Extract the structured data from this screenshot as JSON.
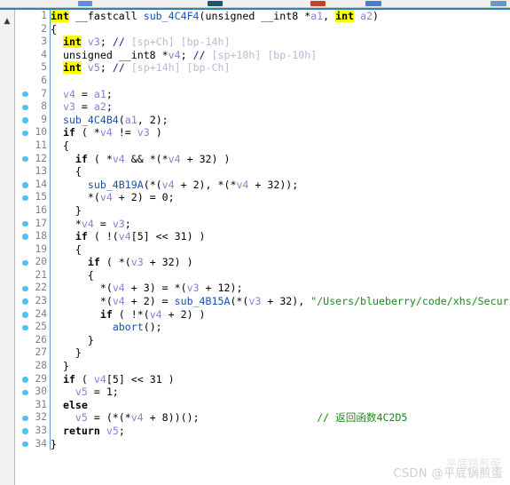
{
  "window": {
    "app": "ida-hexrays-pseudocode",
    "toolbar_icons": [
      "document-icon",
      "navigate-icon",
      "stop-icon",
      "window-icon",
      "grid-icon"
    ],
    "accent_color": "#2e82b5",
    "marker_color": "#4cc3f2",
    "keyword_highlight_color": "#ffff00",
    "string_color": "#1a8a1a",
    "variable_color": "#8a7fd4",
    "function_color": "#1a4fb4",
    "comment_color": "#1a1a8c",
    "gutter_color": "#808080"
  },
  "sidebar": {
    "collapse_icon": "chevron-up-icon"
  },
  "watermark": {
    "text": "CSDN @平底锅煎蛋",
    "ghost": "平底锅煎蛋"
  },
  "code": {
    "language": "c-pseudocode",
    "total_lines": 34,
    "lines": [
      {
        "n": "1",
        "marker": false,
        "html": "<span class=\"kw\">int</span><span class=\"pun\"> __fastcall </span><span class=\"fn\">sub_4C4F4</span><span class=\"pun\">(unsigned __int8 *</span><span class=\"var\">a1</span><span class=\"pun\">, </span><span class=\"kw\">int</span><span class=\"pun\"> </span><span class=\"var\">a2</span><span class=\"pun\">)</span>"
      },
      {
        "n": "2",
        "marker": false,
        "html": "<span class=\"pun\">{</span>"
      },
      {
        "n": "3",
        "marker": false,
        "html": "<span class=\"pun\">  </span><span class=\"kw\">int</span><span class=\"pun\"> </span><span class=\"var\">v3</span><span class=\"pun\">; </span><span class=\"cmt\">//</span><span class=\"cmt-arg\"> [sp+Ch] [bp-14h]</span>"
      },
      {
        "n": "4",
        "marker": false,
        "html": "<span class=\"pun\">  unsigned __int8 *</span><span class=\"var\">v4</span><span class=\"pun\">; </span><span class=\"cmt\">//</span><span class=\"cmt-arg\"> [sp+10h] [bp-10h]</span>"
      },
      {
        "n": "5",
        "marker": false,
        "html": "<span class=\"pun\">  </span><span class=\"kw\">int</span><span class=\"pun\"> </span><span class=\"var\">v5</span><span class=\"pun\">; </span><span class=\"cmt\">//</span><span class=\"cmt-arg\"> [sp+14h] [bp-Ch]</span>"
      },
      {
        "n": "6",
        "marker": false,
        "html": ""
      },
      {
        "n": "7",
        "marker": true,
        "html": "<span class=\"pun\">  </span><span class=\"var\">v4</span><span class=\"pun\"> = </span><span class=\"var\">a1</span><span class=\"pun\">;</span>"
      },
      {
        "n": "8",
        "marker": true,
        "html": "<span class=\"pun\">  </span><span class=\"var\">v3</span><span class=\"pun\"> = </span><span class=\"var\">a2</span><span class=\"pun\">;</span>"
      },
      {
        "n": "9",
        "marker": true,
        "html": "<span class=\"pun\">  </span><span class=\"fn\">sub_4C4B4</span><span class=\"pun\">(</span><span class=\"var\">a1</span><span class=\"pun\">, 2);</span>"
      },
      {
        "n": "10",
        "marker": true,
        "html": "<span class=\"pun\">  </span><span class=\"kw2\">if</span><span class=\"pun\"> ( *</span><span class=\"var\">v4</span><span class=\"pun\"> != </span><span class=\"var\">v3</span><span class=\"pun\"> )</span>"
      },
      {
        "n": "11",
        "marker": false,
        "html": "<span class=\"pun\">  {</span>"
      },
      {
        "n": "12",
        "marker": true,
        "html": "<span class=\"pun\">    </span><span class=\"kw2\">if</span><span class=\"pun\"> ( *</span><span class=\"var\">v4</span><span class=\"pun\"> &amp;&amp; *(*</span><span class=\"var\">v4</span><span class=\"pun\"> + 32) )</span>"
      },
      {
        "n": "13",
        "marker": false,
        "html": "<span class=\"pun\">    {</span>"
      },
      {
        "n": "14",
        "marker": true,
        "html": "<span class=\"pun\">      </span><span class=\"fn\">sub_4B19A</span><span class=\"pun\">(*(</span><span class=\"var\">v4</span><span class=\"pun\"> + 2), *(*</span><span class=\"var\">v4</span><span class=\"pun\"> + 32));</span>"
      },
      {
        "n": "15",
        "marker": true,
        "html": "<span class=\"pun\">      *(</span><span class=\"var\">v4</span><span class=\"pun\"> + 2) = 0;</span>"
      },
      {
        "n": "16",
        "marker": false,
        "html": "<span class=\"pun\">    }</span>"
      },
      {
        "n": "17",
        "marker": true,
        "html": "<span class=\"pun\">    *</span><span class=\"var\">v4</span><span class=\"pun\"> = </span><span class=\"var\">v3</span><span class=\"pun\">;</span>"
      },
      {
        "n": "18",
        "marker": true,
        "html": "<span class=\"pun\">    </span><span class=\"kw2\">if</span><span class=\"pun\"> ( !(</span><span class=\"var\">v4</span><span class=\"pun\">[5] &lt;&lt; 31) )</span>"
      },
      {
        "n": "19",
        "marker": false,
        "html": "<span class=\"pun\">    {</span>"
      },
      {
        "n": "20",
        "marker": true,
        "html": "<span class=\"pun\">      </span><span class=\"kw2\">if</span><span class=\"pun\"> ( *(</span><span class=\"var\">v3</span><span class=\"pun\"> + 32) )</span>"
      },
      {
        "n": "21",
        "marker": false,
        "html": "<span class=\"pun\">      {</span>"
      },
      {
        "n": "22",
        "marker": true,
        "html": "<span class=\"pun\">        *(</span><span class=\"var\">v4</span><span class=\"pun\"> + 3) = *(</span><span class=\"var\">v3</span><span class=\"pun\"> + 12);</span>"
      },
      {
        "n": "23",
        "marker": true,
        "html": "<span class=\"pun\">        *(</span><span class=\"var\">v4</span><span class=\"pun\"> + 2) = </span><span class=\"fn\">sub_4B15A</span><span class=\"pun\">(*(</span><span class=\"var\">v3</span><span class=\"pun\"> + 32), </span><span class=\"str\">\"/Users/blueberry/code/xhs/Securi</span>"
      },
      {
        "n": "24",
        "marker": true,
        "html": "<span class=\"pun\">        </span><span class=\"kw2\">if</span><span class=\"pun\"> ( !*(</span><span class=\"var\">v4</span><span class=\"pun\"> + 2) )</span>"
      },
      {
        "n": "25",
        "marker": true,
        "html": "<span class=\"pun\">          </span><span class=\"fn\">abort</span><span class=\"pun\">();</span>"
      },
      {
        "n": "26",
        "marker": false,
        "html": "<span class=\"pun\">      }</span>"
      },
      {
        "n": "27",
        "marker": false,
        "html": "<span class=\"pun\">    }</span>"
      },
      {
        "n": "28",
        "marker": false,
        "html": "<span class=\"pun\">  }</span>"
      },
      {
        "n": "29",
        "marker": true,
        "html": "<span class=\"pun\">  </span><span class=\"kw2\">if</span><span class=\"pun\"> ( </span><span class=\"var\">v4</span><span class=\"pun\">[5] &lt;&lt; 31 )</span>"
      },
      {
        "n": "30",
        "marker": true,
        "html": "<span class=\"pun\">    </span><span class=\"var\">v5</span><span class=\"pun\"> = 1;</span>"
      },
      {
        "n": "31",
        "marker": false,
        "html": "<span class=\"pun\">  </span><span class=\"kw2\">else</span>"
      },
      {
        "n": "32",
        "marker": true,
        "html": "<span class=\"pun\">    </span><span class=\"var\">v5</span><span class=\"pun\"> = (*(*</span><span class=\"var\">v4</span><span class=\"pun\"> + 8))();                   </span><span class=\"cmtg\">// 返回函数4C2D5</span>"
      },
      {
        "n": "33",
        "marker": true,
        "html": "<span class=\"pun\">  </span><span class=\"kw2\">return</span><span class=\"pun\"> </span><span class=\"var\">v5</span><span class=\"pun\">;</span>"
      },
      {
        "n": "34",
        "marker": true,
        "html": "<span class=\"pun\">}</span>"
      }
    ]
  }
}
